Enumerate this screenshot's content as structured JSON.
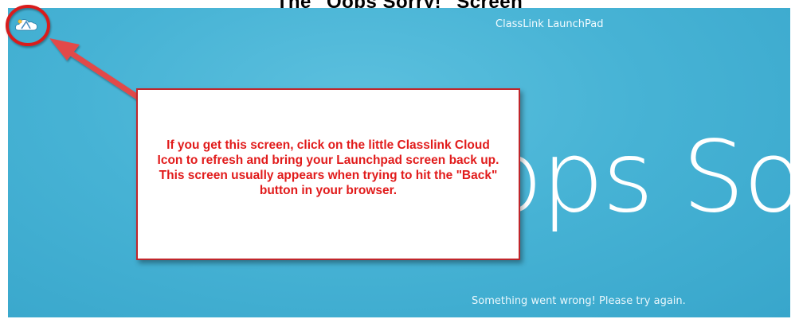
{
  "heading": "The \"Oops Sorry!\" Screen",
  "app": {
    "title": "ClassLink LaunchPad",
    "icon": "classlink-cloud-icon"
  },
  "error": {
    "headline": "Oops Sorry!",
    "message": "Something went wrong! Please try again."
  },
  "annotation": {
    "text": "If you get this screen, click on the little Classlink Cloud Icon to refresh and bring your Launchpad screen back up.  This screen usually appears when trying to hit the \"Back\" button in your browser.",
    "color": "#e11b1b",
    "border_color": "#c0262b",
    "arrow_color": "#e24a4a"
  },
  "colors": {
    "background": "#47b3d5",
    "text": "#ffffff"
  }
}
